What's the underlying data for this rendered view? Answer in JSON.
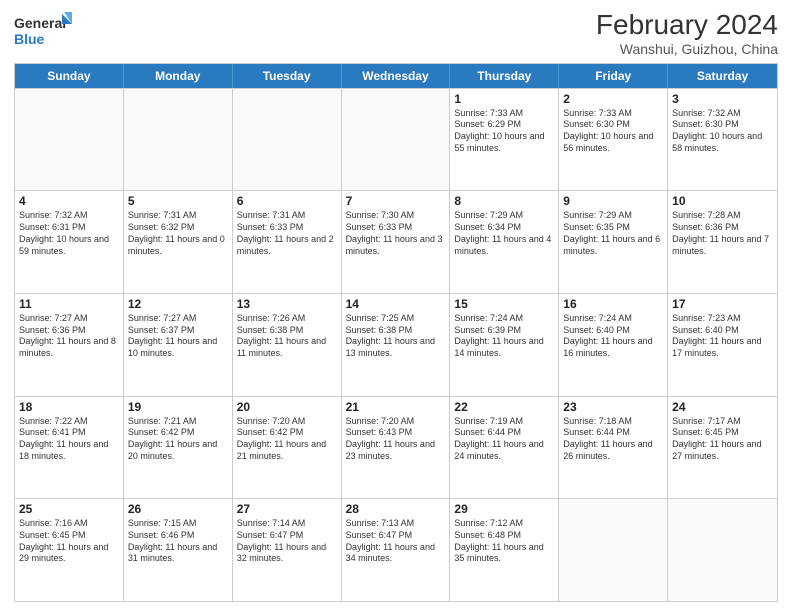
{
  "logo": {
    "line1": "General",
    "line2": "Blue"
  },
  "title": "February 2024",
  "location": "Wanshui, Guizhou, China",
  "days_of_week": [
    "Sunday",
    "Monday",
    "Tuesday",
    "Wednesday",
    "Thursday",
    "Friday",
    "Saturday"
  ],
  "weeks": [
    [
      {
        "day": "",
        "empty": true
      },
      {
        "day": "",
        "empty": true
      },
      {
        "day": "",
        "empty": true
      },
      {
        "day": "",
        "empty": true
      },
      {
        "day": "1",
        "sunrise": "7:33 AM",
        "sunset": "6:29 PM",
        "daylight": "10 hours and 55 minutes."
      },
      {
        "day": "2",
        "sunrise": "7:33 AM",
        "sunset": "6:30 PM",
        "daylight": "10 hours and 56 minutes."
      },
      {
        "day": "3",
        "sunrise": "7:32 AM",
        "sunset": "6:30 PM",
        "daylight": "10 hours and 58 minutes."
      }
    ],
    [
      {
        "day": "4",
        "sunrise": "7:32 AM",
        "sunset": "6:31 PM",
        "daylight": "10 hours and 59 minutes."
      },
      {
        "day": "5",
        "sunrise": "7:31 AM",
        "sunset": "6:32 PM",
        "daylight": "11 hours and 0 minutes."
      },
      {
        "day": "6",
        "sunrise": "7:31 AM",
        "sunset": "6:33 PM",
        "daylight": "11 hours and 2 minutes."
      },
      {
        "day": "7",
        "sunrise": "7:30 AM",
        "sunset": "6:33 PM",
        "daylight": "11 hours and 3 minutes."
      },
      {
        "day": "8",
        "sunrise": "7:29 AM",
        "sunset": "6:34 PM",
        "daylight": "11 hours and 4 minutes."
      },
      {
        "day": "9",
        "sunrise": "7:29 AM",
        "sunset": "6:35 PM",
        "daylight": "11 hours and 6 minutes."
      },
      {
        "day": "10",
        "sunrise": "7:28 AM",
        "sunset": "6:36 PM",
        "daylight": "11 hours and 7 minutes."
      }
    ],
    [
      {
        "day": "11",
        "sunrise": "7:27 AM",
        "sunset": "6:36 PM",
        "daylight": "11 hours and 8 minutes."
      },
      {
        "day": "12",
        "sunrise": "7:27 AM",
        "sunset": "6:37 PM",
        "daylight": "11 hours and 10 minutes."
      },
      {
        "day": "13",
        "sunrise": "7:26 AM",
        "sunset": "6:38 PM",
        "daylight": "11 hours and 11 minutes."
      },
      {
        "day": "14",
        "sunrise": "7:25 AM",
        "sunset": "6:38 PM",
        "daylight": "11 hours and 13 minutes."
      },
      {
        "day": "15",
        "sunrise": "7:24 AM",
        "sunset": "6:39 PM",
        "daylight": "11 hours and 14 minutes."
      },
      {
        "day": "16",
        "sunrise": "7:24 AM",
        "sunset": "6:40 PM",
        "daylight": "11 hours and 16 minutes."
      },
      {
        "day": "17",
        "sunrise": "7:23 AM",
        "sunset": "6:40 PM",
        "daylight": "11 hours and 17 minutes."
      }
    ],
    [
      {
        "day": "18",
        "sunrise": "7:22 AM",
        "sunset": "6:41 PM",
        "daylight": "11 hours and 18 minutes."
      },
      {
        "day": "19",
        "sunrise": "7:21 AM",
        "sunset": "6:42 PM",
        "daylight": "11 hours and 20 minutes."
      },
      {
        "day": "20",
        "sunrise": "7:20 AM",
        "sunset": "6:42 PM",
        "daylight": "11 hours and 21 minutes."
      },
      {
        "day": "21",
        "sunrise": "7:20 AM",
        "sunset": "6:43 PM",
        "daylight": "11 hours and 23 minutes."
      },
      {
        "day": "22",
        "sunrise": "7:19 AM",
        "sunset": "6:44 PM",
        "daylight": "11 hours and 24 minutes."
      },
      {
        "day": "23",
        "sunrise": "7:18 AM",
        "sunset": "6:44 PM",
        "daylight": "11 hours and 26 minutes."
      },
      {
        "day": "24",
        "sunrise": "7:17 AM",
        "sunset": "6:45 PM",
        "daylight": "11 hours and 27 minutes."
      }
    ],
    [
      {
        "day": "25",
        "sunrise": "7:16 AM",
        "sunset": "6:45 PM",
        "daylight": "11 hours and 29 minutes."
      },
      {
        "day": "26",
        "sunrise": "7:15 AM",
        "sunset": "6:46 PM",
        "daylight": "11 hours and 31 minutes."
      },
      {
        "day": "27",
        "sunrise": "7:14 AM",
        "sunset": "6:47 PM",
        "daylight": "11 hours and 32 minutes."
      },
      {
        "day": "28",
        "sunrise": "7:13 AM",
        "sunset": "6:47 PM",
        "daylight": "11 hours and 34 minutes."
      },
      {
        "day": "29",
        "sunrise": "7:12 AM",
        "sunset": "6:48 PM",
        "daylight": "11 hours and 35 minutes."
      },
      {
        "day": "",
        "empty": true
      },
      {
        "day": "",
        "empty": true
      }
    ]
  ]
}
